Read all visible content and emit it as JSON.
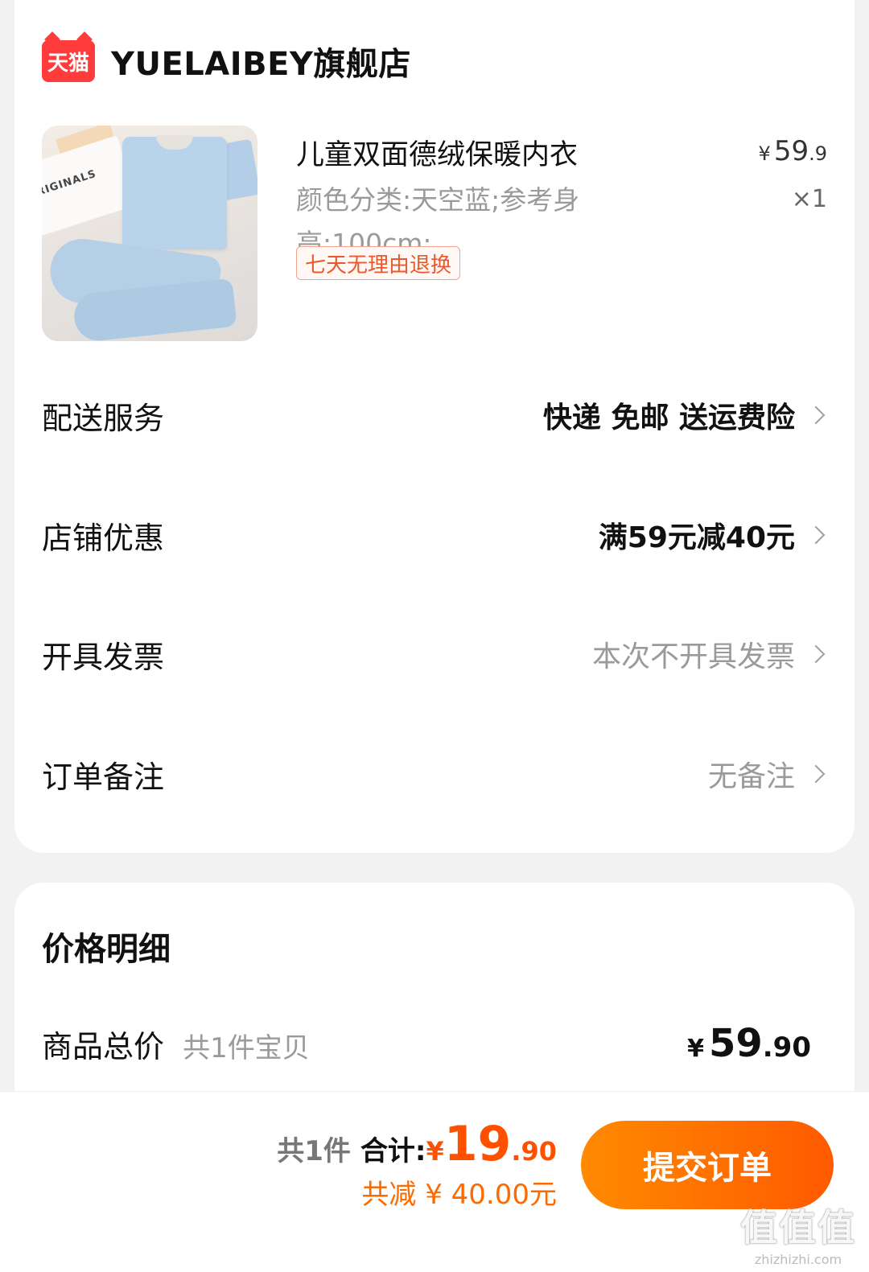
{
  "shop": {
    "badge": "天猫",
    "name": "YUELAIBEY旗舰店"
  },
  "product": {
    "image_caption": "RIGINALS",
    "title": "儿童双面德绒保暖内衣",
    "spec": "颜色分类:天空蓝;参考身高:100cm;",
    "price_symbol": "¥",
    "price_int": "59",
    "price_dec": ".9",
    "quantity": "×1",
    "return_policy": "七天无理由退换"
  },
  "order_rows": [
    {
      "label": "配送服务",
      "value": "快递 免邮 送运费险"
    },
    {
      "label": "店铺优惠",
      "value": "满59元减40元"
    },
    {
      "label": "开具发票",
      "value": "本次不开具发票"
    },
    {
      "label": "订单备注",
      "value": "无备注"
    }
  ],
  "price_detail": {
    "title": "价格明细",
    "goods_total_label": "商品总价",
    "goods_total_sub": "共1件宝贝",
    "goods_total_symbol": "¥",
    "goods_total_int": "59",
    "goods_total_dec": ".90"
  },
  "bottom_bar": {
    "count": "共1件",
    "total_label": "合计:",
    "total_symbol": "¥",
    "total_int": "19",
    "total_dec": ".90",
    "discount": "共减 ¥ 40.00元",
    "submit_label": "提交订单"
  },
  "watermark": {
    "logo": "值值值",
    "url": "zhizhizhi.com"
  },
  "colors": {
    "accent": "#ff5000",
    "tmall_red": "#ff3b3b",
    "button_start": "#ff8a00",
    "button_end": "#ff5a00"
  }
}
